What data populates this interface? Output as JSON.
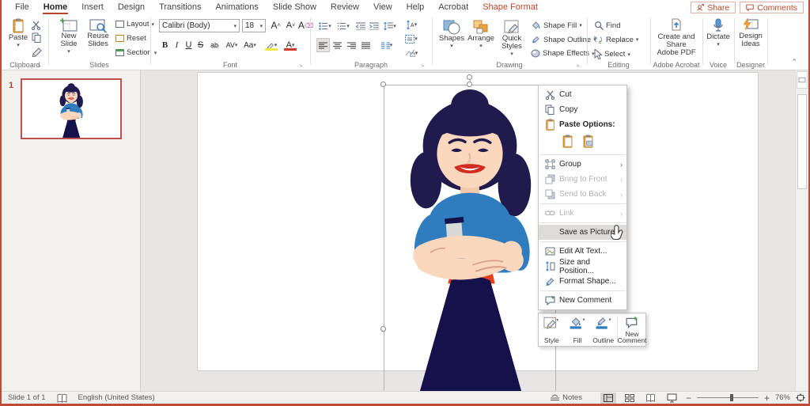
{
  "menubar": {
    "tabs": [
      "File",
      "Home",
      "Insert",
      "Design",
      "Transitions",
      "Animations",
      "Slide Show",
      "Review",
      "View",
      "Help",
      "Acrobat",
      "Shape Format"
    ],
    "share": "Share",
    "comments": "Comments"
  },
  "ribbon": {
    "clipboard": {
      "label": "Clipboard",
      "paste": "Paste"
    },
    "slides": {
      "label": "Slides",
      "new_slide": "New Slide",
      "reuse_slides": "Reuse Slides",
      "layout": "Layout",
      "reset": "Reset",
      "section": "Section"
    },
    "font": {
      "label": "Font",
      "family": "Calibri (Body)",
      "size": "18",
      "bold": "B",
      "italic": "I",
      "underline": "U",
      "strike": "S",
      "shadow": "ab",
      "spacing": "AV",
      "case": "Aa",
      "color": "A"
    },
    "paragraph": {
      "label": "Paragraph"
    },
    "drawing": {
      "label": "Drawing",
      "shapes": "Shapes",
      "arrange": "Arrange",
      "quick_styles": "Quick Styles",
      "shape_fill": "Shape Fill",
      "shape_outline": "Shape Outline",
      "shape_effects": "Shape Effects"
    },
    "editing": {
      "label": "Editing",
      "find": "Find",
      "replace": "Replace",
      "select": "Select"
    },
    "acrobat": {
      "label": "Adobe Acrobat",
      "button_line1": "Create and Share",
      "button_line2": "Adobe PDF"
    },
    "voice": {
      "label": "Voice",
      "dictate": "Dictate"
    },
    "designer": {
      "label": "Designer",
      "button_line1": "Design",
      "button_line2": "Ideas"
    }
  },
  "slide_panel": {
    "slide_number": "1"
  },
  "context_menu": {
    "cut": "Cut",
    "copy": "Copy",
    "paste_options": "Paste Options:",
    "group": "Group",
    "bring_to_front": "Bring to Front",
    "send_to_back": "Send to Back",
    "link": "Link",
    "save_as_picture": "Save as Picture...",
    "edit_alt_text": "Edit Alt Text...",
    "size_and_position": "Size and Position...",
    "format_shape": "Format Shape...",
    "new_comment": "New Comment"
  },
  "mini_toolbar": {
    "style": "Style",
    "fill": "Fill",
    "outline": "Outline",
    "new_comment_line1": "New",
    "new_comment_line2": "Comment"
  },
  "status_bar": {
    "slide_indicator": "Slide 1 of 1",
    "language": "English (United States)",
    "notes": "Notes",
    "zoom_level": "76%"
  }
}
